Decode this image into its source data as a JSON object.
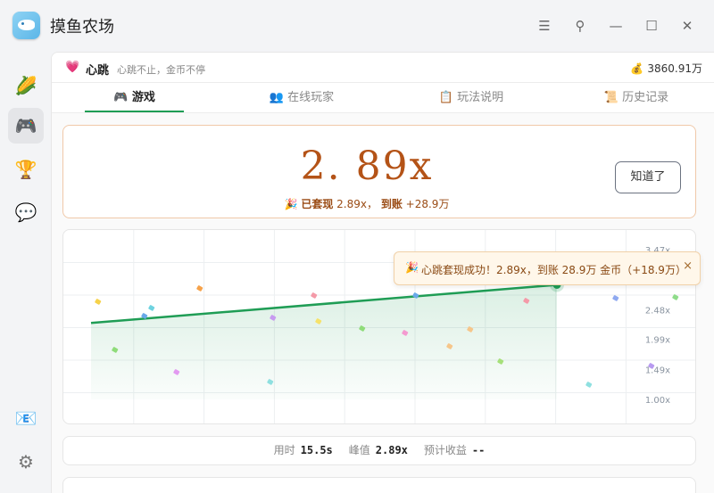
{
  "app": {
    "title": "摸鱼农场"
  },
  "window_controls": {
    "menu": "☰",
    "pin": "⚲",
    "minimize": "—",
    "maximize": "☐",
    "close": "✕"
  },
  "sidebar": {
    "items": [
      {
        "name": "farm",
        "icon": "corn-icon",
        "glyph": "🌽"
      },
      {
        "name": "games",
        "icon": "gamepad-icon",
        "glyph": "🎮"
      },
      {
        "name": "leaderboard",
        "icon": "trophy-icon",
        "glyph": "🏆"
      },
      {
        "name": "chat",
        "icon": "chat-bubble-icon",
        "glyph": "💬"
      }
    ],
    "bottom": [
      {
        "name": "mail",
        "icon": "mail-icon",
        "glyph": "📧"
      },
      {
        "name": "settings",
        "icon": "gear-icon",
        "glyph": "⚙"
      }
    ]
  },
  "header": {
    "icon_glyph": "💗",
    "title": "心跳",
    "subtitle": "心跳不止，金币不停",
    "balance_icon": "💰",
    "balance": "3860.91万"
  },
  "tabs": [
    {
      "label": "游戏",
      "glyph": "🎮",
      "active": true
    },
    {
      "label": "在线玩家",
      "glyph": "👥",
      "active": false
    },
    {
      "label": "玩法说明",
      "glyph": "📋",
      "active": false
    },
    {
      "label": "历史记录",
      "glyph": "📜",
      "active": false
    }
  ],
  "result": {
    "multiplier": "2. 89x",
    "note_icon": "🎉",
    "note_prefix": "已套现",
    "note_mult": "2.89x，",
    "note_mid": "到账",
    "note_amount": "+28.9万",
    "ok_button": "知道了"
  },
  "toast": {
    "icon": "🎉",
    "text": "心跳套现成功！2.89x，到账 28.9万 金币（+18.9万）",
    "close": "×"
  },
  "chart_data": {
    "type": "line",
    "x_range": [
      0,
      15.5
    ],
    "y_ticks": [
      "3.47x",
      "2.48x",
      "1.99x",
      "1.49x",
      "1.00x"
    ],
    "series": [
      {
        "x": [
          0,
          15.5
        ],
        "y": [
          2.26,
          2.89
        ]
      }
    ],
    "grid": true,
    "line_color": "#1f9d55"
  },
  "stats": {
    "time_label": "用时",
    "time_value": "15.5s",
    "peak_label": "峰值",
    "peak_value": "2.89x",
    "expected_label": "预计收益",
    "expected_value": "--"
  }
}
